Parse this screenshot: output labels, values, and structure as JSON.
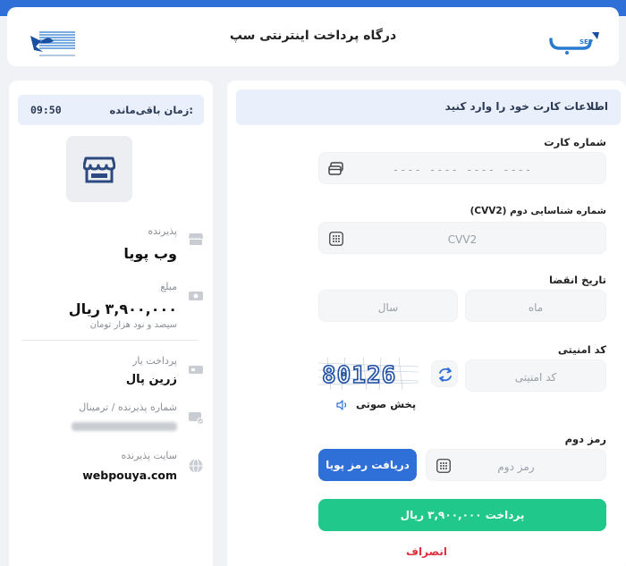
{
  "header": {
    "title": "درگاه پرداخت اینترنتی سپ",
    "sep_logo_text": "SEP"
  },
  "form": {
    "info_text": "اطلاعات کارت خود را وارد کنید",
    "card_number_label": "شماره کارت",
    "card_number_placeholder": "---- ---- ---- ----",
    "cvv2_label": "شماره شناسایی دوم (CVV2)",
    "cvv2_placeholder": "CVV2",
    "expiry_label": "تاریخ انقضا",
    "month_placeholder": "ماه",
    "year_placeholder": "سال",
    "captcha_label": "کد امنیتی",
    "captcha_placeholder": "کد امنیتی",
    "captcha_image_text": "80126",
    "audio_label": "پخش صوتی",
    "otp_label": "رمز دوم",
    "otp_placeholder": "رمز دوم",
    "otp_button": "دریافت رمز پویا",
    "pay_button": "پرداخت ۳,۹۰۰,۰۰۰ ریال",
    "cancel_link": "انصراف"
  },
  "summary": {
    "timer_label": "زمان باقی‌مانده:",
    "timer_value": "09:50",
    "merchant_label": "پذیرنده",
    "merchant_value": "وب پویا",
    "amount_label": "مبلغ",
    "amount_value": "۳,۹۰۰,۰۰۰ ریال",
    "amount_words": "سیصد و نود هزار تومان",
    "psp_label": "پرداخت یار",
    "psp_value": "زرین پال",
    "terminal_label": "شماره پذیرنده / ترمینال",
    "site_label": "سایت پذیرنده",
    "site_value": "webpouya.com"
  },
  "colors": {
    "primary": "#2f6fd8",
    "success": "#20c98b",
    "danger": "#e0303f"
  }
}
